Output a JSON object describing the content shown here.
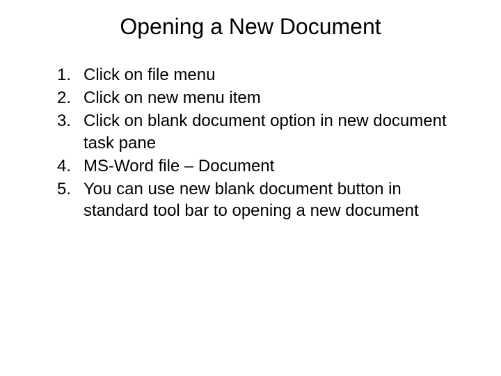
{
  "title": "Opening a New Document",
  "items": [
    {
      "num": "1.",
      "text": "Click on file menu"
    },
    {
      "num": "2.",
      "text": "Click on new menu item"
    },
    {
      "num": "3.",
      "text": "Click on blank document option in new document task pane"
    },
    {
      "num": "4.",
      "text": "MS-Word file – Document"
    },
    {
      "num": "5.",
      "text": "You can use new blank document button in standard tool bar to opening a new document"
    }
  ]
}
